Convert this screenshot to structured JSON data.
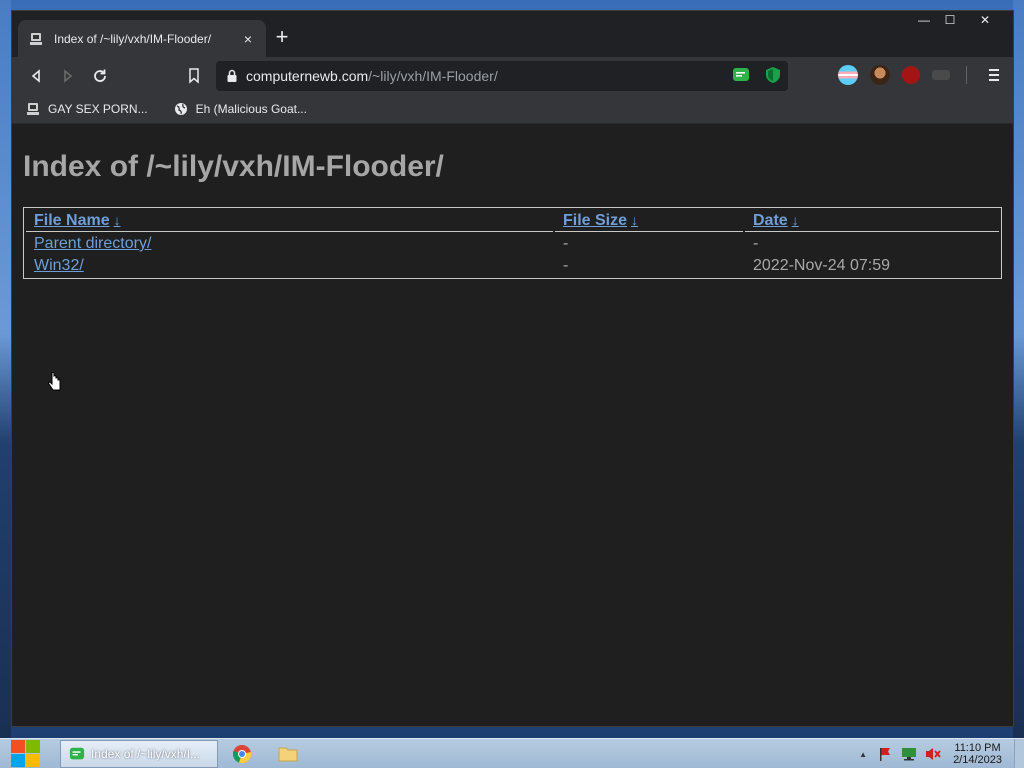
{
  "browser": {
    "tab": {
      "title": "Index of /~lily/vxh/IM-Flooder/",
      "close": "×"
    },
    "new_tab": "+",
    "window_controls": {
      "minimize": "—",
      "maximize": "☐",
      "close": "✕"
    },
    "address": {
      "host": "computernewb.com",
      "path": "/~lily/vxh/IM-Flooder/"
    },
    "bookmarks": [
      {
        "label": "GAY SEX PORN..."
      },
      {
        "label": "Eh (Malicious Goat..."
      }
    ]
  },
  "page": {
    "heading": "Index of /~lily/vxh/IM-Flooder/",
    "columns": [
      {
        "label": "File Name",
        "sort": "↓"
      },
      {
        "label": "File Size",
        "sort": "↓"
      },
      {
        "label": "Date",
        "sort": "↓"
      }
    ],
    "rows": [
      {
        "name": "Parent directory/",
        "size": "-",
        "date": "-"
      },
      {
        "name": "Win32/",
        "size": "-",
        "date": "2022-Nov-24 07:59"
      }
    ]
  },
  "taskbar": {
    "active_window": "Index of /~lily/vxh/I...",
    "clock": {
      "time": "11:10 PM",
      "date": "2/14/2023"
    }
  }
}
